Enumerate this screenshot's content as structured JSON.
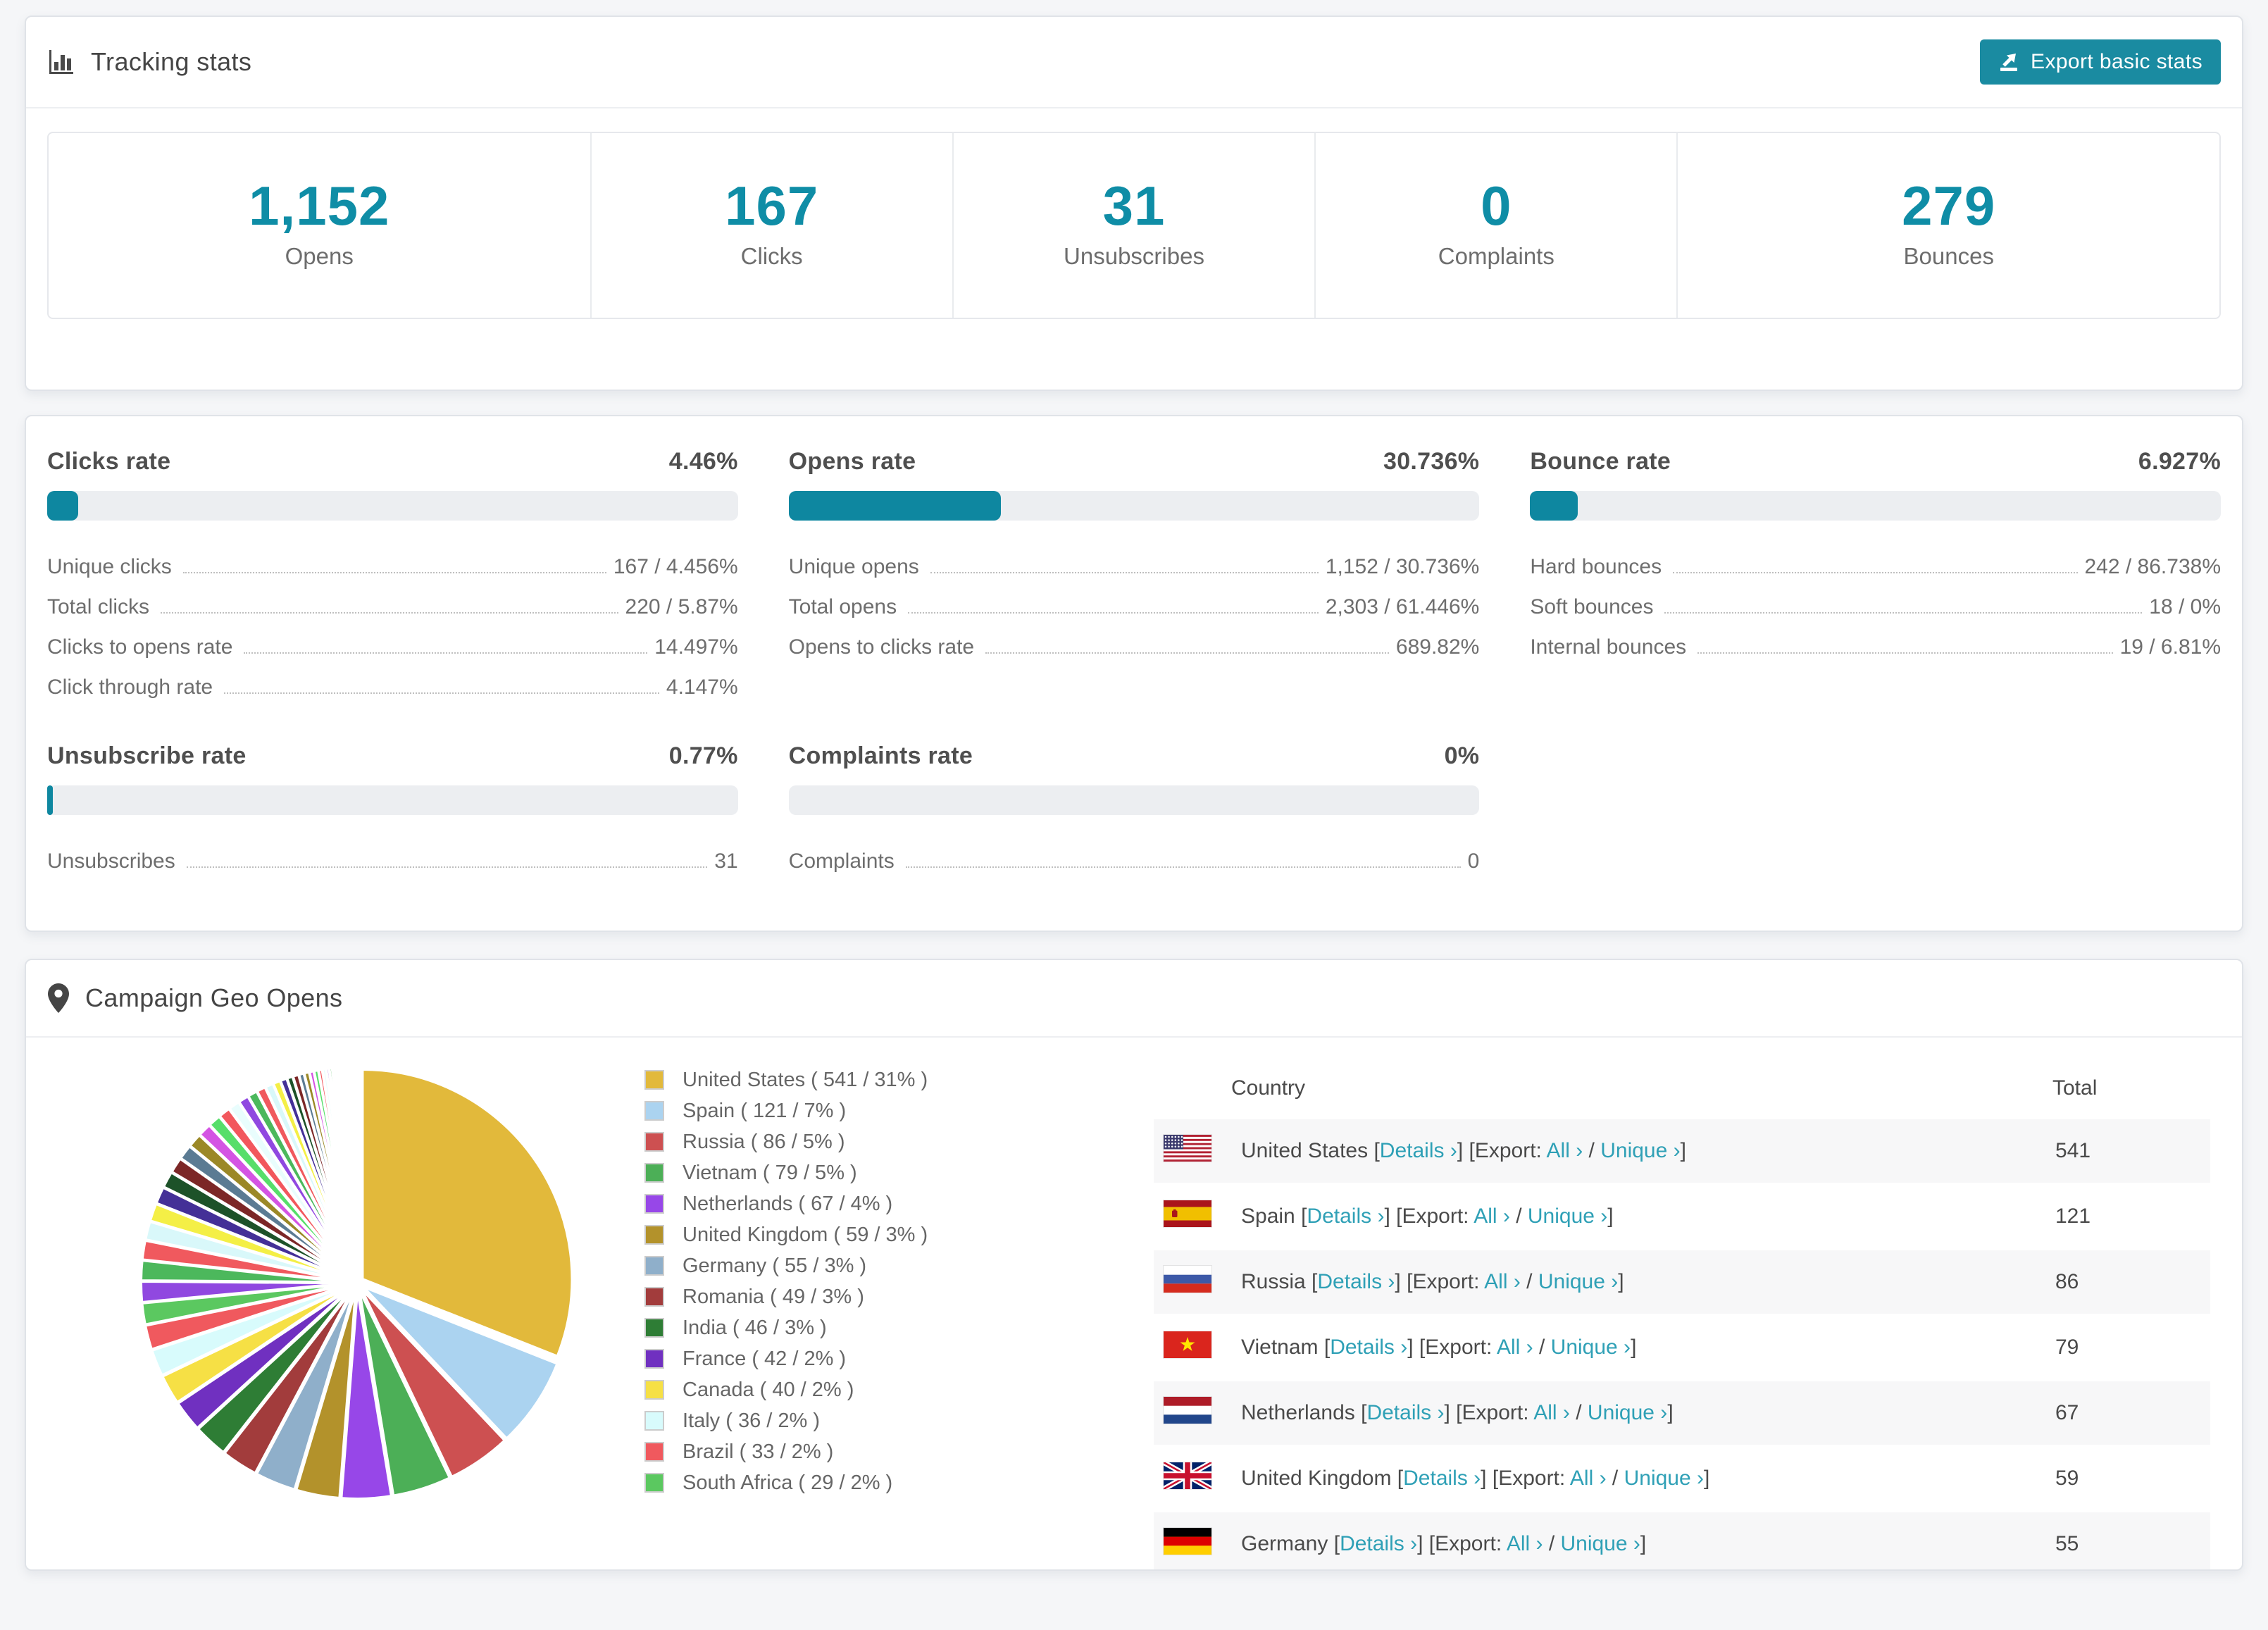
{
  "colors": {
    "accent_bar": "#0e87a0",
    "accent_number": "#0f8da6",
    "link": "#2fa0b6",
    "button_bg": "#1a8ba1",
    "page_bg": "#f5f6f8"
  },
  "tracking": {
    "title": "Tracking stats",
    "export_button": "Export basic stats",
    "stats": [
      {
        "value": "1,152",
        "label": "Opens"
      },
      {
        "value": "167",
        "label": "Clicks"
      },
      {
        "value": "31",
        "label": "Unsubscribes"
      },
      {
        "value": "0",
        "label": "Complaints"
      },
      {
        "value": "279",
        "label": "Bounces"
      }
    ]
  },
  "rates": [
    {
      "title": "Clicks rate",
      "value": "4.46%",
      "bar_pct": 4.46,
      "rows": [
        {
          "label": "Unique clicks",
          "value": "167 / 4.456%"
        },
        {
          "label": "Total clicks",
          "value": "220 / 5.87%"
        },
        {
          "label": "Clicks to opens rate",
          "value": "14.497%"
        },
        {
          "label": "Click through rate",
          "value": "4.147%"
        }
      ]
    },
    {
      "title": "Opens rate",
      "value": "30.736%",
      "bar_pct": 30.736,
      "rows": [
        {
          "label": "Unique opens",
          "value": "1,152 / 30.736%"
        },
        {
          "label": "Total opens",
          "value": "2,303 / 61.446%"
        },
        {
          "label": "Opens to clicks rate",
          "value": "689.82%"
        }
      ]
    },
    {
      "title": "Bounce rate",
      "value": "6.927%",
      "bar_pct": 6.927,
      "rows": [
        {
          "label": "Hard bounces",
          "value": "242 / 86.738%"
        },
        {
          "label": "Soft bounces",
          "value": "18 / 0%"
        },
        {
          "label": "Internal bounces",
          "value": "19 / 6.81%"
        }
      ]
    },
    {
      "title": "Unsubscribe rate",
      "value": "0.77%",
      "bar_pct": 0.77,
      "rows": [
        {
          "label": "Unsubscribes",
          "value": "31"
        }
      ]
    },
    {
      "title": "Complaints rate",
      "value": "0%",
      "bar_pct": 0,
      "rows": [
        {
          "label": "Complaints",
          "value": "0"
        }
      ]
    }
  ],
  "geo": {
    "title": "Campaign Geo Opens",
    "table": {
      "headers": [
        "Country",
        "Total"
      ],
      "link_text": {
        "details": "Details",
        "export": "Export:",
        "all": "All",
        "unique": "Unique",
        "chevron": "›"
      },
      "rows": [
        {
          "country": "United States",
          "flag": "us",
          "total": "541"
        },
        {
          "country": "Spain",
          "flag": "es",
          "total": "121"
        },
        {
          "country": "Russia",
          "flag": "ru",
          "total": "86"
        },
        {
          "country": "Vietnam",
          "flag": "vn",
          "total": "79"
        },
        {
          "country": "Netherlands",
          "flag": "nl",
          "total": "67"
        },
        {
          "country": "United Kingdom",
          "flag": "gb",
          "total": "59"
        },
        {
          "country": "Germany",
          "flag": "de",
          "total": "55"
        }
      ]
    }
  },
  "chart_data": {
    "type": "pie",
    "title": "Campaign Geo Opens",
    "legend_position": "right",
    "series": [
      {
        "name": "United States",
        "value": 541,
        "pct": 31,
        "color": "#e2b93b"
      },
      {
        "name": "Spain",
        "value": 121,
        "pct": 7,
        "color": "#abd3f0"
      },
      {
        "name": "Russia",
        "value": 86,
        "pct": 5,
        "color": "#cd5051"
      },
      {
        "name": "Vietnam",
        "value": 79,
        "pct": 5,
        "color": "#4caf57"
      },
      {
        "name": "Netherlands",
        "value": 67,
        "pct": 4,
        "color": "#9747e8"
      },
      {
        "name": "United Kingdom",
        "value": 59,
        "pct": 3,
        "color": "#b3922b"
      },
      {
        "name": "Germany",
        "value": 55,
        "pct": 3,
        "color": "#8fafca"
      },
      {
        "name": "Romania",
        "value": 49,
        "pct": 3,
        "color": "#a23c3c"
      },
      {
        "name": "India",
        "value": 46,
        "pct": 3,
        "color": "#2e7d35"
      },
      {
        "name": "France",
        "value": 42,
        "pct": 2,
        "color": "#7030c0"
      },
      {
        "name": "Canada",
        "value": 40,
        "pct": 2,
        "color": "#f6e045"
      },
      {
        "name": "Italy",
        "value": 36,
        "pct": 2,
        "color": "#d8fbfc"
      },
      {
        "name": "Brazil",
        "value": 33,
        "pct": 2,
        "color": "#f0595e"
      },
      {
        "name": "South Africa",
        "value": 29,
        "pct": 2,
        "color": "#5bc860"
      }
    ],
    "other_slices": {
      "values": [
        28,
        27,
        26,
        25,
        24,
        23,
        22,
        21,
        20,
        19,
        18,
        17,
        16,
        15,
        14,
        13,
        12,
        11,
        10,
        9,
        8,
        8,
        7,
        7,
        6,
        6,
        5,
        5,
        4,
        4,
        3,
        3,
        3,
        2,
        2,
        2,
        2,
        1,
        1,
        1,
        1,
        1,
        1,
        1,
        1,
        1,
        1,
        1,
        1,
        1,
        1,
        1
      ],
      "palette": [
        "#9048e0",
        "#4cb85c",
        "#f0595e",
        "#d9f8fa",
        "#f4ef46",
        "#443097",
        "#1d5229",
        "#7c2727",
        "#5b7b93",
        "#9b8827",
        "#d454e3",
        "#57de6a",
        "#f2575d",
        "#e9fdfd"
      ]
    }
  }
}
